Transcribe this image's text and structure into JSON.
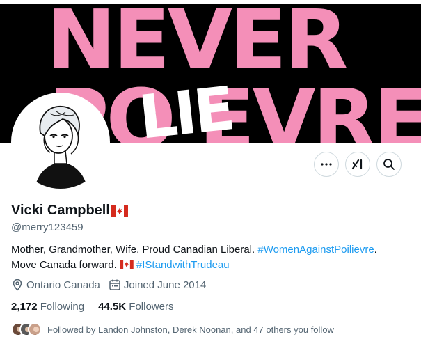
{
  "banner": {
    "line1": "NEVER",
    "line2": "PO    EVRE",
    "overlay": "LIE"
  },
  "profile": {
    "display_name": "Vicki Campbell",
    "handle": "@merry123459",
    "bio_text_1": "Mother, Grandmother, Wife. Proud Canadian Liberal. ",
    "bio_hashtag_1": "#WomenAgainstPoilievre",
    "bio_text_2": ".",
    "bio_text_3": "Move Canada forward. ",
    "bio_hashtag_2": "#IStandwithTrudeau",
    "location": "Ontario Canada",
    "joined": "Joined June 2014",
    "following_count": "2,172",
    "following_label": "Following",
    "followers_count": "44.5K",
    "followers_label": "Followers",
    "followed_by": "Followed by Landon Johnston, Derek Noonan, and 47 others you follow"
  },
  "actions": {
    "more_icon": "more-icon",
    "grok_icon": "grok-icon",
    "search_icon": "search-icon"
  },
  "colors": {
    "accent": "#1d9bf0",
    "banner_pink": "#f48fb8",
    "secondary_text": "#536471",
    "flag_red": "#d52b1e"
  }
}
